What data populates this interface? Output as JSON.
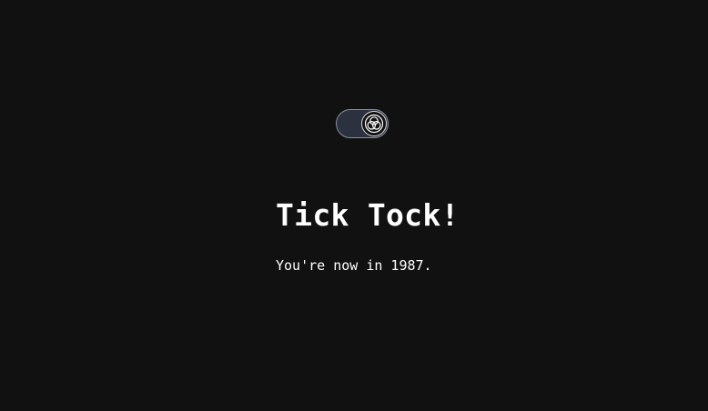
{
  "toggle": {
    "state": "on",
    "icon": "triquetra-icon",
    "track_color": "#2c3140",
    "border_color": "#8a8f9c"
  },
  "main": {
    "title": "Tick Tock!",
    "subtitle": "You're now in 1987."
  },
  "colors": {
    "background": "#111111",
    "text": "#ffffff"
  }
}
